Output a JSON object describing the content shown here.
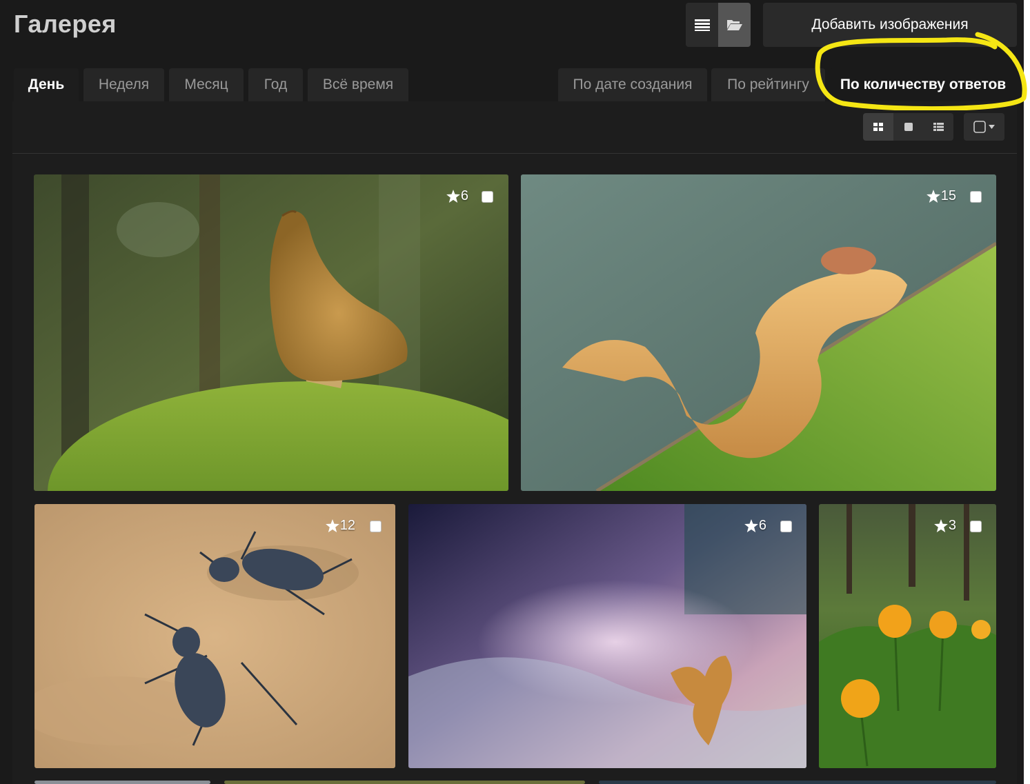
{
  "header": {
    "title": "Галерея",
    "add_button_label": "Добавить изображения"
  },
  "view_toggle": [
    {
      "icon": "list-icon",
      "active": false
    },
    {
      "icon": "folder-open-icon",
      "active": true
    }
  ],
  "period_tabs": [
    {
      "label": "День",
      "active": true
    },
    {
      "label": "Неделя",
      "active": false
    },
    {
      "label": "Месяц",
      "active": false
    },
    {
      "label": "Год",
      "active": false
    },
    {
      "label": "Всё время",
      "active": false
    }
  ],
  "sort_tabs": [
    {
      "label": "По дате создания",
      "active": false
    },
    {
      "label": "По рейтингу",
      "active": false
    },
    {
      "label": "По количеству ответов",
      "active": true
    }
  ],
  "layout_buttons": [
    {
      "icon": "grid-large-icon",
      "active": true
    },
    {
      "icon": "square-icon",
      "active": false
    },
    {
      "icon": "list-rows-icon",
      "active": false
    }
  ],
  "select_dropdown": {
    "icon": "checkbox-icon"
  },
  "photos": [
    {
      "subject": "mushroom",
      "rating": "6"
    },
    {
      "subject": "caterpillar",
      "rating": "15"
    },
    {
      "subject": "beetles",
      "rating": "12"
    },
    {
      "subject": "abstract-bokeh",
      "rating": "6"
    },
    {
      "subject": "orange-flowers",
      "rating": "3"
    }
  ],
  "annotation": {
    "color": "#f5e614"
  }
}
